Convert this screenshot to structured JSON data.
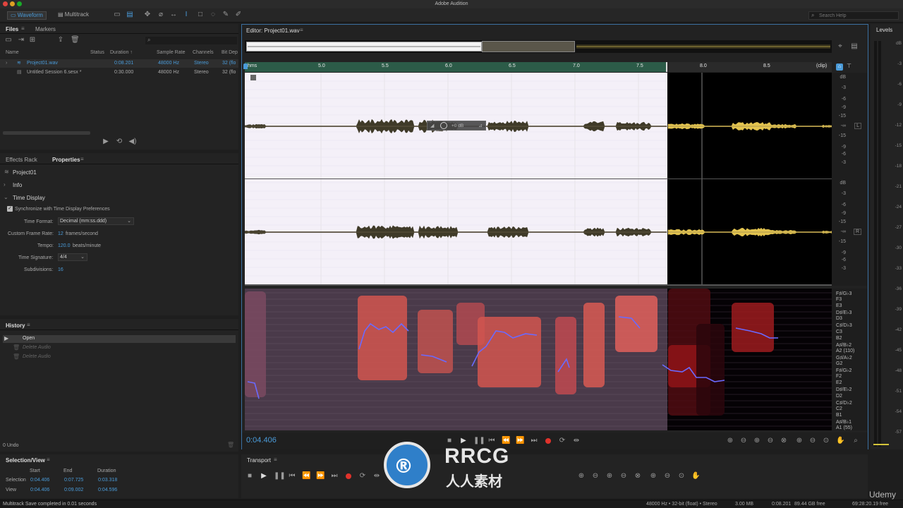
{
  "window": {
    "title": "Adobe Audition"
  },
  "toolbar": {
    "waveform_tab": "Waveform",
    "multitrack_tab": "Multitrack",
    "search_placeholder": "Search Help"
  },
  "files_panel": {
    "tabs": [
      "Files",
      "Markers"
    ],
    "columns": [
      "Name",
      "Status",
      "Duration ↑",
      "Sample Rate",
      "Channels",
      "Bit Dep"
    ],
    "rows": [
      {
        "name": "Project01.wav",
        "duration": "0:08.201",
        "sample_rate": "48000 Hz",
        "channels": "Stereo",
        "bit_depth": "32 (flo"
      },
      {
        "name": "Untitled Session 6.sesx *",
        "duration": "0:30.000",
        "sample_rate": "48000 Hz",
        "channels": "Stereo",
        "bit_depth": "32 (flo"
      }
    ]
  },
  "properties_panel": {
    "tabs": [
      "Effects Rack",
      "Properties"
    ],
    "file_name": "Project01",
    "info_label": "Info",
    "time_display_label": "Time Display",
    "sync_label": "Synchronize with Time Display Preferences",
    "time_format_label": "Time Format:",
    "time_format_value": "Decimal (mm:ss.ddd)",
    "frame_rate_label": "Custom Frame Rate:",
    "frame_rate_value": "12",
    "frame_rate_unit": "frames/second",
    "tempo_label": "Tempo:",
    "tempo_value": "120.0",
    "tempo_unit": "beats/minute",
    "time_sig_label": "Time Signature:",
    "time_sig_value": "4/4",
    "subdiv_label": "Subdivisions:",
    "subdiv_value": "16"
  },
  "history_panel": {
    "title": "History",
    "items": [
      "Open",
      "Delete Audio",
      "Delete Audio"
    ],
    "undo_label": "0 Undo"
  },
  "selection_panel": {
    "title": "Selection/View",
    "col_start": "Start",
    "col_end": "End",
    "col_duration": "Duration",
    "selection_label": "Selection",
    "selection_start": "0:04.406",
    "selection_end": "0:07.725",
    "selection_duration": "0:03.318",
    "view_label": "View",
    "view_start": "0:04.406",
    "view_end": "0:09.002",
    "view_duration": "0:04.596"
  },
  "editor": {
    "title": "Editor: Project01.wav",
    "ruler_ticks": [
      "hms",
      "5.0",
      "5.5",
      "6.0",
      "6.5",
      "7.0",
      "7.5",
      "8.0",
      "8.5",
      "(clip)"
    ],
    "db_scale": [
      "dB",
      "-3",
      "-6",
      "-9",
      "-15",
      "-∞",
      "-15",
      "-9",
      "-6",
      "-3"
    ],
    "hud_value": "+0 dB",
    "pitch_labels": [
      "F♯/G♭3",
      "F3",
      "E3",
      "D♯/E♭3",
      "D3",
      "C♯/D♭3",
      "C3",
      "B2",
      "A♯/B♭2",
      "A2 (110)",
      "G♯/A♭2",
      "G2",
      "F♯/G♭2",
      "F2",
      "E2",
      "D♯/E♭2",
      "D2",
      "C♯/D♭2",
      "C2",
      "B1",
      "A♯/B♭1",
      "A1 (55)"
    ],
    "current_time": "0:04.406",
    "channel_l": "L",
    "channel_r": "R"
  },
  "levels": {
    "title": "Levels",
    "scale": [
      "dB",
      "-3",
      "-6",
      "-9",
      "-12",
      "-15",
      "-18",
      "-21",
      "-24",
      "-27",
      "-30",
      "-33",
      "-36",
      "-39",
      "-42",
      "-45",
      "-48",
      "-51",
      "-54",
      "-57"
    ]
  },
  "transport_panel": {
    "title": "Transport"
  },
  "status_bar": {
    "left": "Multitrack Save completed in 0.01 seconds",
    "format": "48000 Hz • 32-bit (float) • Stereo",
    "size": "3.00 MB",
    "duration": "0:08.201",
    "free": "89.44 GB free",
    "time_free": "69:28:20.19 free"
  },
  "watermark": {
    "brand": "RRCG",
    "sub": "人人素材",
    "udemy": "Udemy"
  },
  "colors": {
    "accent": "#4a9bd9",
    "waveform_selected": "#3f3a28",
    "waveform_unselected": "#e3c44f",
    "record": "#e0322b"
  }
}
